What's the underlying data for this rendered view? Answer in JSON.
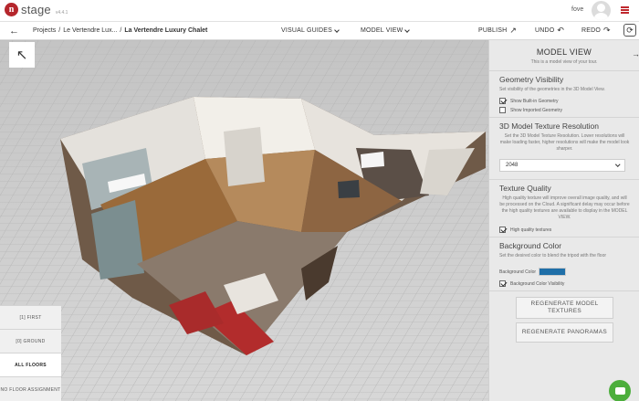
{
  "app": {
    "logo_mark": "n",
    "logo_text": "stage",
    "logo_sub": "v4.4.1",
    "user_name": "fove"
  },
  "nav": {
    "breadcrumb": [
      "Projects",
      "/",
      "Le Vertendre Lux...",
      "/"
    ],
    "current": "La Vertendre Luxury Chalet",
    "visual_guides": "VISUAL GUIDES",
    "model_view": "MODEL VIEW",
    "publish": "PUBLISH",
    "undo": "UNDO",
    "redo": "REDO"
  },
  "icons": {
    "back": "arrow-left-icon",
    "expand": "arrow-up-left-icon",
    "publish": "arrow-up-right-icon",
    "undo": "undo-icon",
    "redo": "redo-icon",
    "refresh": "refresh-icon",
    "menu": "hamburger-icon",
    "chat": "chat-icon"
  },
  "floors": [
    "[1] FIRST",
    "[0] GROUND",
    "ALL FLOORS",
    "NO FLOOR ASSIGNMENT"
  ],
  "active_floor": "ALL FLOORS",
  "panel": {
    "title": "MODEL VIEW",
    "subtitle": "This is a model view of your tour.",
    "geometry": {
      "title": "Geometry Visibility",
      "desc": "Set visibility of the geometries in the 3D Model View.",
      "opt1": "Show Built-in Geometry",
      "opt1_checked": true,
      "opt2": "Show Imported Geometry",
      "opt2_checked": false
    },
    "texture_res": {
      "title": "3D Model Texture Resolution",
      "desc": "Set the 3D Model Texture Resolution. Lower resolutions will make loading faster, higher resolutions will make the model look sharper.",
      "value": "2048"
    },
    "texture_quality": {
      "title": "Texture Quality",
      "desc": "High quality texture will improve overall image quality, and will be processed on the Cloud. A significant delay may occur before the high quality textures are available to display in the MODEL VIEW.",
      "opt": "High quality textures",
      "checked": true
    },
    "background": {
      "title": "Background Color",
      "desc": "Set the desired color to blend the tripod with the floor",
      "color_label": "Background Color",
      "color": "#1f6fa8",
      "visibility_label": "Background Color Visibility",
      "visibility_checked": true
    },
    "buttons": {
      "regen_textures": "REGENERATE MODEL TEXTURES",
      "regen_panoramas": "REGENERATE PANORAMAS"
    }
  },
  "colors": {
    "brand": "#b5262c",
    "chat": "#4cae3c"
  }
}
